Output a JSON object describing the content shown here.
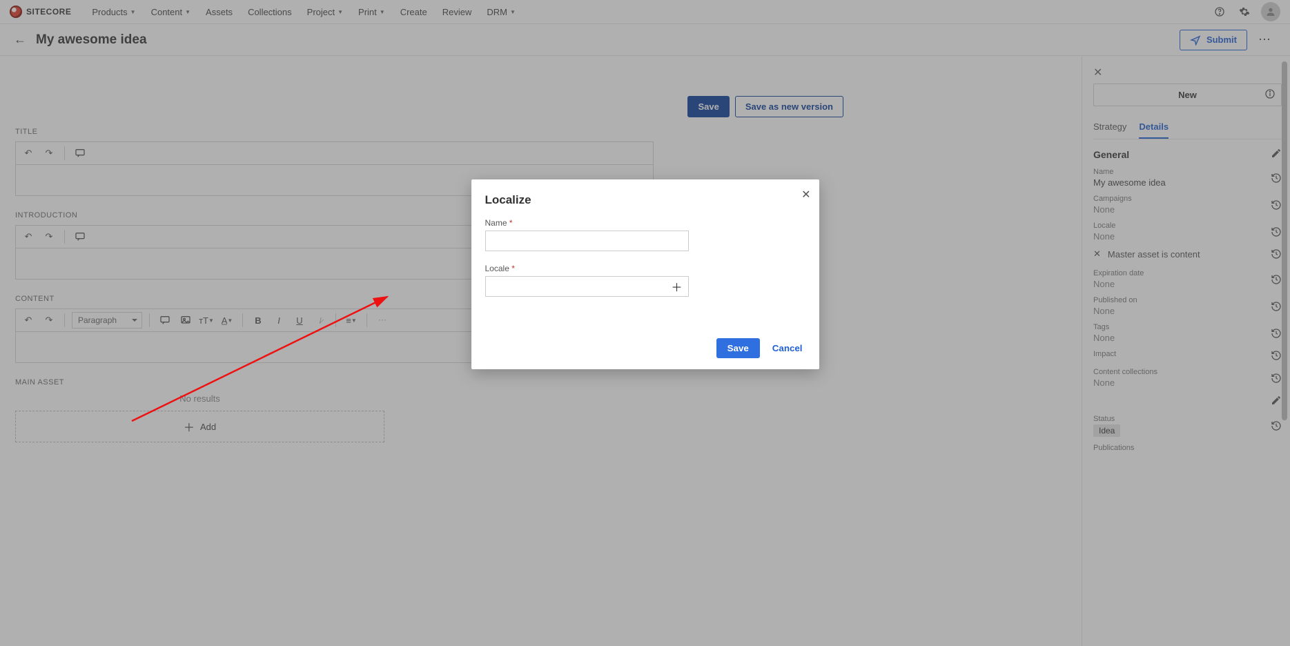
{
  "brand": {
    "name": "SITECORE"
  },
  "nav": {
    "items": [
      {
        "label": "Products",
        "dropdown": true
      },
      {
        "label": "Content",
        "dropdown": true
      },
      {
        "label": "Assets",
        "dropdown": false
      },
      {
        "label": "Collections",
        "dropdown": false
      },
      {
        "label": "Project",
        "dropdown": true
      },
      {
        "label": "Print",
        "dropdown": true
      },
      {
        "label": "Create",
        "dropdown": false
      },
      {
        "label": "Review",
        "dropdown": false
      },
      {
        "label": "DRM",
        "dropdown": true
      }
    ]
  },
  "page": {
    "title": "My awesome idea",
    "submit": "Submit"
  },
  "editor": {
    "save": "Save",
    "save_new_version": "Save as new version",
    "sections": {
      "title": "TITLE",
      "introduction": "INTRODUCTION",
      "content": "CONTENT",
      "main_asset": "MAIN ASSET"
    },
    "paragraph": "Paragraph",
    "no_results": "No results",
    "add": "Add"
  },
  "sidebar": {
    "new": "New",
    "tabs": {
      "strategy": "Strategy",
      "details": "Details"
    },
    "general": "General",
    "fields": {
      "name": {
        "label": "Name",
        "value": "My awesome idea"
      },
      "campaigns": {
        "label": "Campaigns",
        "value": "None"
      },
      "locale": {
        "label": "Locale",
        "value": "None"
      },
      "master": {
        "label": "Master asset is content"
      },
      "expiration": {
        "label": "Expiration date",
        "value": "None"
      },
      "published": {
        "label": "Published on",
        "value": "None"
      },
      "tags": {
        "label": "Tags",
        "value": "None"
      },
      "impact": {
        "label": "Impact",
        "value": ""
      },
      "collections": {
        "label": "Content collections",
        "value": "None"
      },
      "status": {
        "label": "Status",
        "value": "Idea"
      },
      "publications": {
        "label": "Publications"
      }
    }
  },
  "modal": {
    "title": "Localize",
    "name_label": "Name",
    "locale_label": "Locale",
    "save": "Save",
    "cancel": "Cancel"
  }
}
